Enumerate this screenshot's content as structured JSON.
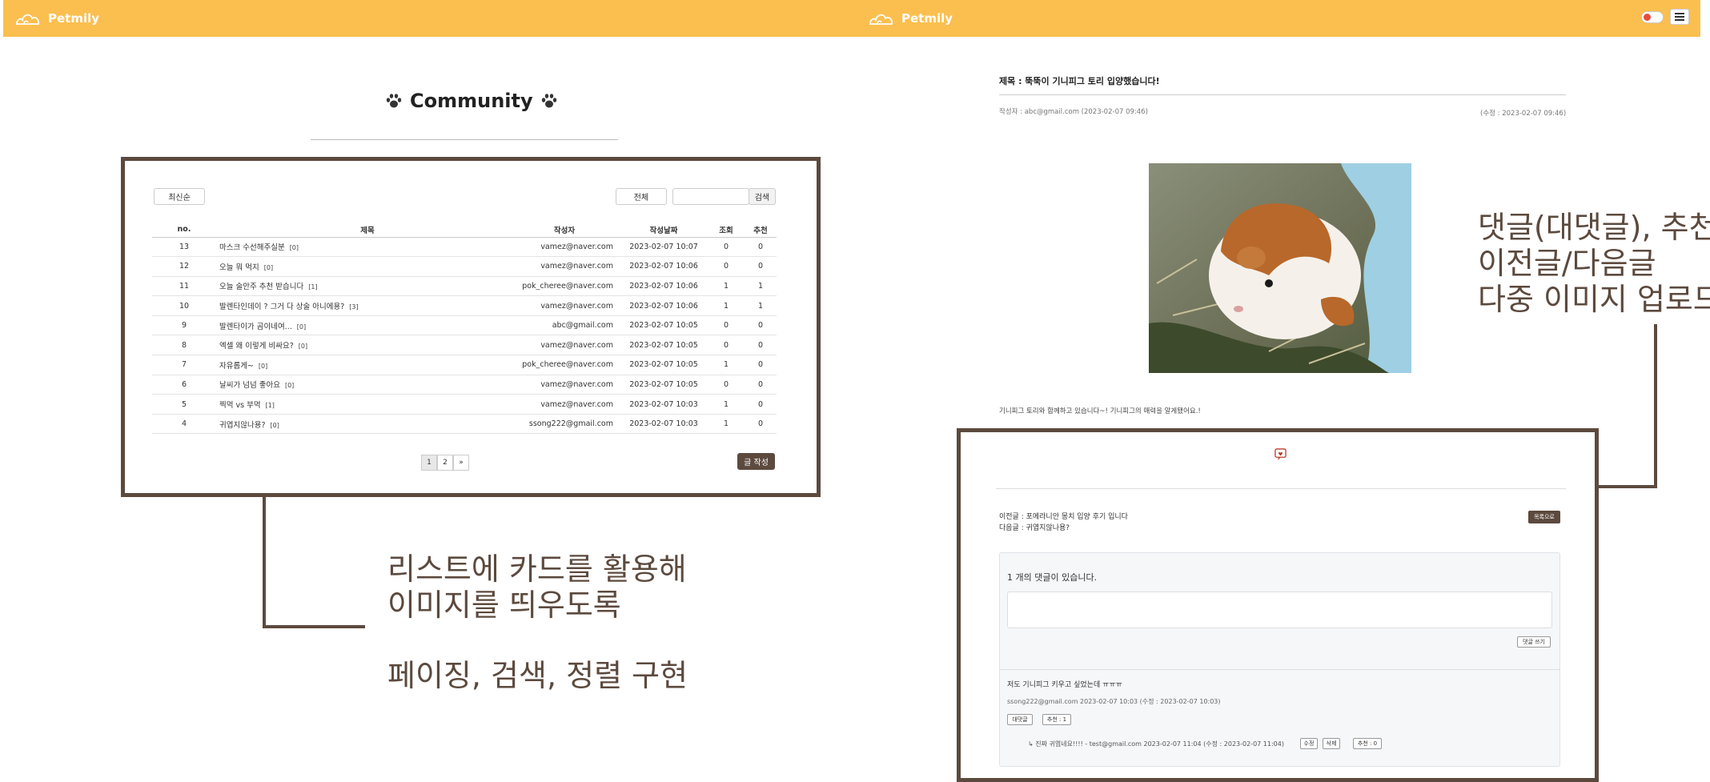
{
  "brand": "Petmily",
  "left": {
    "page_title": "Community",
    "sort_button": "최신순",
    "filter_select": "전체",
    "search_button": "검색",
    "columns": [
      "no.",
      "제목",
      "작성자",
      "작성날짜",
      "조회",
      "추천"
    ],
    "rows": [
      {
        "no": "13",
        "title": "마스크 수선해주실분",
        "comments": "[0]",
        "writer": "vamez@naver.com",
        "date": "2023-02-07 10:07",
        "views": "0",
        "rec": "0"
      },
      {
        "no": "12",
        "title": "오늘 뭐 먹지",
        "comments": "[0]",
        "writer": "vamez@naver.com",
        "date": "2023-02-07 10:06",
        "views": "0",
        "rec": "0"
      },
      {
        "no": "11",
        "title": "오늘 술안주 추천 받습니다",
        "comments": "[1]",
        "writer": "pok_cheree@naver.com",
        "date": "2023-02-07 10:06",
        "views": "1",
        "rec": "1"
      },
      {
        "no": "10",
        "title": "발렌타인데이 ? 그거 다 상술 아니에용?",
        "comments": "[3]",
        "writer": "vamez@naver.com",
        "date": "2023-02-07 10:06",
        "views": "1",
        "rec": "1"
      },
      {
        "no": "9",
        "title": "발렌타이가 곰이네여...",
        "comments": "[0]",
        "writer": "abc@gmail.com",
        "date": "2023-02-07 10:05",
        "views": "0",
        "rec": "0"
      },
      {
        "no": "8",
        "title": "엑셀 왜 이렇게 비싸요?",
        "comments": "[0]",
        "writer": "vamez@naver.com",
        "date": "2023-02-07 10:05",
        "views": "0",
        "rec": "0"
      },
      {
        "no": "7",
        "title": "자유롭게~",
        "comments": "[0]",
        "writer": "pok_cheree@naver.com",
        "date": "2023-02-07 10:05",
        "views": "1",
        "rec": "0"
      },
      {
        "no": "6",
        "title": "날씨가 넘넘 좋아요",
        "comments": "[0]",
        "writer": "vamez@naver.com",
        "date": "2023-02-07 10:05",
        "views": "0",
        "rec": "0"
      },
      {
        "no": "5",
        "title": "찍먹 vs 부먹",
        "comments": "[1]",
        "writer": "vamez@naver.com",
        "date": "2023-02-07 10:03",
        "views": "1",
        "rec": "0"
      },
      {
        "no": "4",
        "title": "귀엽지않나용?",
        "comments": "[0]",
        "writer": "ssong222@gmail.com",
        "date": "2023-02-07 10:03",
        "views": "1",
        "rec": "0"
      }
    ],
    "pages": [
      "1",
      "2",
      "»"
    ],
    "write_button": "글 작성",
    "annotation_1": [
      "리스트에 카드를 활용해",
      "이미지를 띄우도록"
    ],
    "annotation_2": "페이징, 검색, 정렬 구현"
  },
  "right": {
    "post_title": "제목 : 뚝뚝이 기니피그 토리 입양했습니다!",
    "writer_meta": "작성자 : abc@gmail.com (2023-02-07 09:46)",
    "edit_meta": "(수정 : 2023-02-07 09:46)",
    "body": "기니피그 토리와 함께하고 있습니다~! 기니피그의 매력을 알게됐어요.!",
    "prev": "이전글 : 포메라니안 몽치 입양 후기 입니다",
    "next": "다음글 : 귀엽지않나용?",
    "list_button": "목록으로",
    "comment_count": "1 개의 댓글이 있습니다.",
    "comment_submit": "댓글 쓰기",
    "comment": {
      "text": "저도 기니피그 키우고 싶었는데 ㅠㅠㅠ",
      "meta": "ssong222@gmail.com 2023-02-07 10:03 (수정 : 2023-02-07 10:03)",
      "reply_button": "대댓글",
      "rec_button": "추천 : 1"
    },
    "reply": {
      "text": "↳ 진짜 귀엽네요!!!! - test@gmail.com 2023-02-07 11:04 (수정 : 2023-02-07 11:04)",
      "edit_button": "수정",
      "delete_button": "삭제",
      "rec_button": "추천 : 0"
    },
    "annotation": [
      "댓글(대댓글), 추천",
      "이전글/다음글",
      "다중 이미지 업로드"
    ]
  },
  "colors": {
    "navbar": "#fbbf4f",
    "accent": "#5c4a3e"
  }
}
